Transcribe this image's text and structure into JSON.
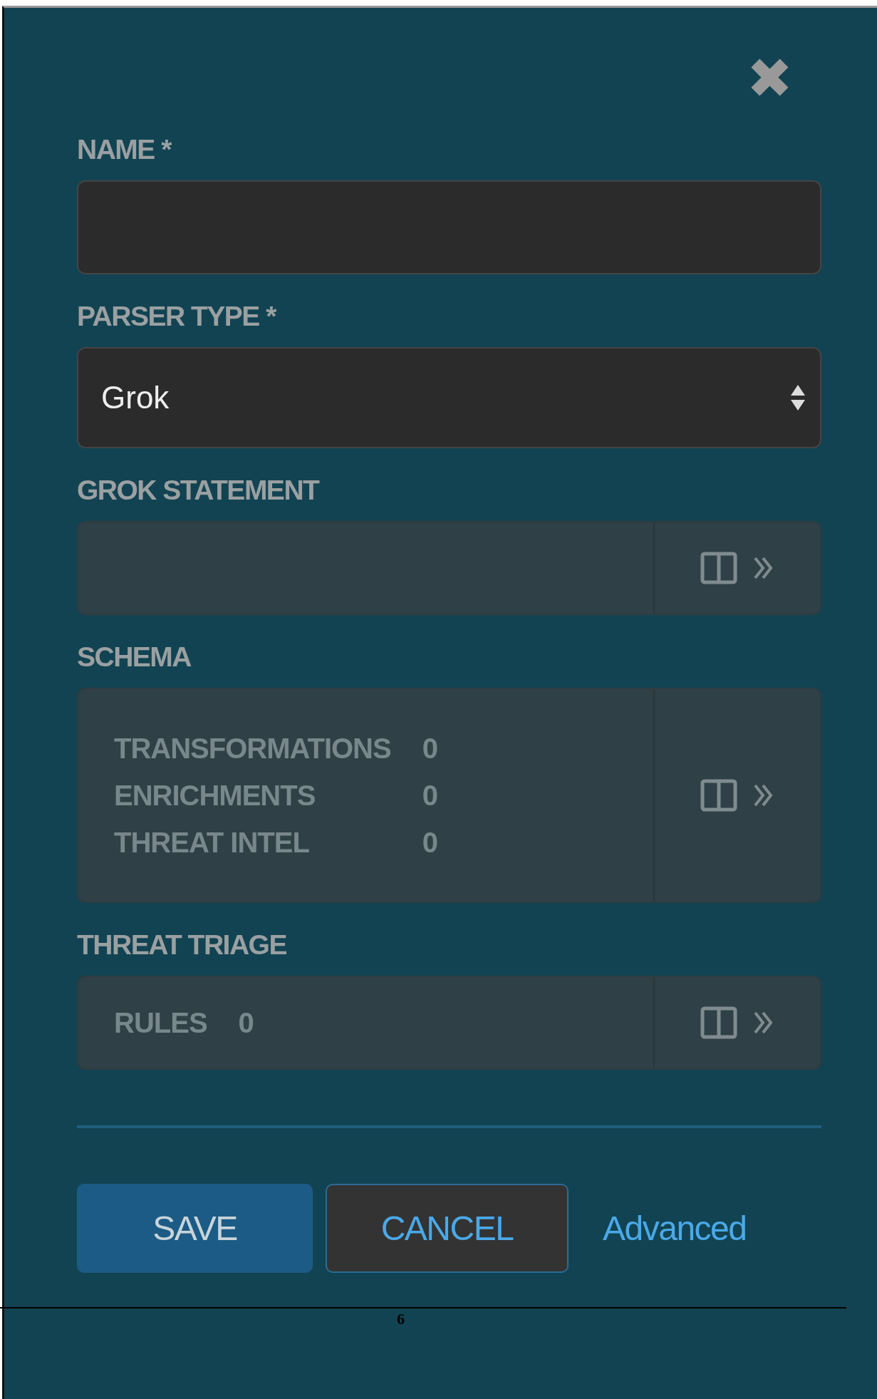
{
  "close_button": {
    "label": "✖"
  },
  "fields": [
    {
      "kind": "text",
      "label": "NAME *"
    },
    {
      "kind": "select",
      "label": "PARSER TYPE *",
      "value": "Grok"
    },
    {
      "kind": "panel",
      "label": "GROK STATEMENT"
    },
    {
      "kind": "panel",
      "label": "SCHEMA",
      "rows": [
        {
          "name": "TRANSFORMATIONS",
          "count": "0"
        },
        {
          "name": "ENRICHMENTS",
          "count": "0"
        },
        {
          "name": "THREAT INTEL",
          "count": "0"
        }
      ]
    },
    {
      "kind": "inline",
      "label": "THREAT TRIAGE",
      "rows": [
        {
          "name": "RULES",
          "count": "0"
        }
      ]
    }
  ],
  "page_number": "6",
  "buttons": [
    {
      "kind": "primary",
      "label": "SAVE"
    },
    {
      "kind": "outline",
      "label": "CANCEL"
    },
    {
      "kind": "link",
      "label": "Advanced"
    }
  ]
}
